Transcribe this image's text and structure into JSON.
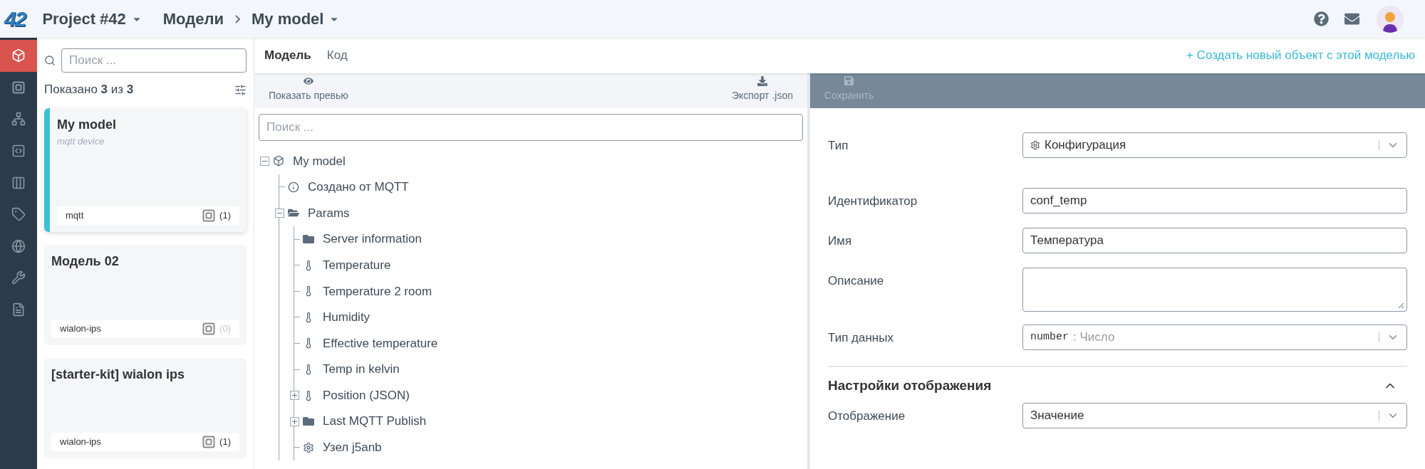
{
  "header": {
    "logo": "42",
    "project": "Project #42",
    "breadcrumbs": [
      "Модели",
      "My model"
    ]
  },
  "rail": [
    {
      "kind": "cube",
      "selected": true
    },
    {
      "kind": "device",
      "selected": false
    },
    {
      "kind": "hierarchy",
      "selected": false
    },
    {
      "kind": "code",
      "selected": false
    },
    {
      "kind": "columns",
      "selected": false
    },
    {
      "kind": "tag",
      "selected": false
    },
    {
      "kind": "globe",
      "selected": false
    },
    {
      "kind": "tools",
      "selected": false
    },
    {
      "kind": "document",
      "selected": false
    }
  ],
  "models_panel": {
    "search_placeholder": "Поиск ...",
    "shown": "Показано **3** из **3**",
    "cards": [
      {
        "title": "My model",
        "subtitle": "mqtt device",
        "tag": "mqtt",
        "count": "(1)",
        "muted": false,
        "selected": true
      },
      {
        "title": "Модель 02",
        "tag": "wialon-ips",
        "count": "(0)",
        "muted": true,
        "selected": false
      },
      {
        "title": "[starter-kit] wialon ips",
        "tag": "wialon-ips",
        "count": "(1)",
        "muted": false,
        "selected": false
      }
    ]
  },
  "tabs": [
    {
      "label": "Модель",
      "selected": true
    },
    {
      "label": "Код",
      "selected": false
    }
  ],
  "create_link": "+ Создать новый объект с этой моделью",
  "toolbar": {
    "preview": "Показать превью",
    "export": "Экспорт .json"
  },
  "tree": {
    "search_placeholder": "Поиск ...",
    "root": {
      "label": "My model",
      "kind": "cube",
      "expanded": true,
      "children": [
        {
          "label": "Создано от MQTT",
          "kind": "info"
        },
        {
          "label": "Params",
          "kind": "folder",
          "expanded": true,
          "children": [
            {
              "label": "Server information",
              "kind": "folder"
            },
            {
              "label": "Temperature",
              "kind": "parameter"
            },
            {
              "label": "Temperature 2 room",
              "kind": "parameter"
            },
            {
              "label": "Humidity",
              "kind": "parameter"
            },
            {
              "label": "Effective temperature",
              "kind": "parameter"
            },
            {
              "label": "Temp in kelvin",
              "kind": "parameter"
            },
            {
              "label": "Position (JSON)",
              "kind": "parameter",
              "expanded": false
            },
            {
              "label": "Last MQTT Publish",
              "kind": "folder",
              "expanded": false
            },
            {
              "label": "Узел j5anb",
              "kind": "config"
            }
          ]
        }
      ]
    }
  },
  "editor": {
    "save": "Сохранить",
    "save_disabled": true,
    "fields": [
      {
        "kind": "type_select",
        "label": "Тип",
        "value": "Конфигурация"
      },
      {
        "kind": "input",
        "label": "Идентификатор",
        "value": "conf_temp"
      },
      {
        "kind": "input",
        "label": "Имя",
        "value": "Температура"
      },
      {
        "kind": "textarea",
        "label": "Описание"
      },
      {
        "kind": "select",
        "label": "Тип данных",
        "code": "number",
        "value": ": Число",
        "muted": true
      }
    ],
    "section": {
      "title": "Настройки отображения",
      "expanded": true,
      "fields": [
        {
          "kind": "select",
          "label": "Отображение",
          "value": "Значение"
        }
      ]
    }
  }
}
